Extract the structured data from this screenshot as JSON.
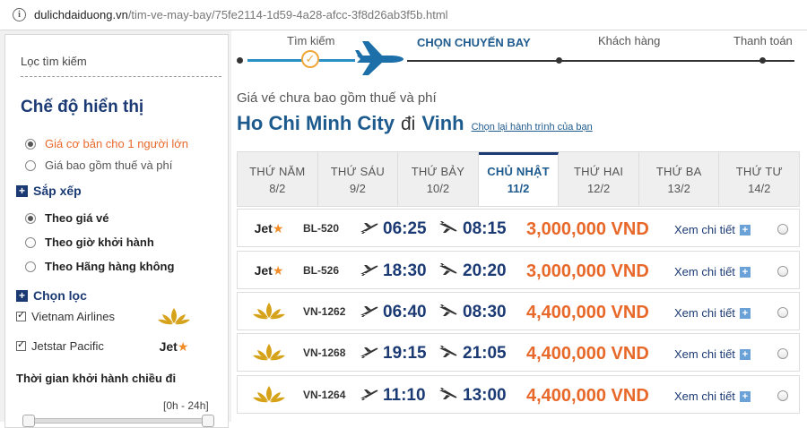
{
  "browser": {
    "url_host": "dulichdaiduong.vn",
    "url_path": "/tim-ve-may-bay/75fe2114-1d59-4a28-afcc-3f8d26ab3f5b.html"
  },
  "sidebar": {
    "filter_title": "Lọc tìm kiếm",
    "display_mode_title": "Chế độ hiển thị",
    "display_options": [
      {
        "label": "Giá cơ bản cho 1 người lớn",
        "selected": true
      },
      {
        "label": "Giá bao gồm thuế và phí",
        "selected": false
      }
    ],
    "sort_title": "Sắp xếp",
    "sort_options": [
      {
        "label": "Theo giá vé",
        "selected": true
      },
      {
        "label": "Theo giờ khởi hành",
        "selected": false
      },
      {
        "label": "Theo Hãng hàng không",
        "selected": false
      }
    ],
    "filter_section_title": "Chọn lọc",
    "airlines": [
      {
        "label": "Vietnam Airlines",
        "checked": true,
        "logo": "lotus-logo"
      },
      {
        "label": "Jetstar Pacific",
        "checked": true,
        "logo": "jetstar-logo"
      }
    ],
    "time_title": "Thời gian khởi hành chiều đi",
    "time_range": "[0h - 24h]"
  },
  "stepper": {
    "steps": [
      {
        "label": "Tìm kiếm",
        "state": "done"
      },
      {
        "label": "CHỌN CHUYẾN BAY",
        "state": "current"
      },
      {
        "label": "Khách hàng",
        "state": "todo"
      },
      {
        "label": "Thanh toán",
        "state": "todo"
      }
    ]
  },
  "results": {
    "note": "Giá vé chưa bao gồm thuế và phí",
    "from": "Ho Chi Minh City",
    "connector": "đi",
    "to": "Vinh",
    "change_link": "Chọn lại hành trình của bạn"
  },
  "day_tabs": [
    {
      "day": "THỨ NĂM",
      "date": "8/2",
      "active": false
    },
    {
      "day": "THỨ SÁU",
      "date": "9/2",
      "active": false
    },
    {
      "day": "THỨ BẢY",
      "date": "10/2",
      "active": false
    },
    {
      "day": "CHỦ NHẬT",
      "date": "11/2",
      "active": true
    },
    {
      "day": "THỨ HAI",
      "date": "12/2",
      "active": false
    },
    {
      "day": "THỨ BA",
      "date": "13/2",
      "active": false
    },
    {
      "day": "THỨ TƯ",
      "date": "14/2",
      "active": false
    }
  ],
  "flights": [
    {
      "airline": "jetstar-logo",
      "code": "BL-520",
      "depart": "06:25",
      "arrive": "08:15",
      "price": "3,000,000 VND",
      "detail": "Xem chi tiết"
    },
    {
      "airline": "jetstar-logo",
      "code": "BL-526",
      "depart": "18:30",
      "arrive": "20:20",
      "price": "3,000,000 VND",
      "detail": "Xem chi tiết"
    },
    {
      "airline": "lotus-logo",
      "code": "VN-1262",
      "depart": "06:40",
      "arrive": "08:30",
      "price": "4,400,000 VND",
      "detail": "Xem chi tiết"
    },
    {
      "airline": "lotus-logo",
      "code": "VN-1268",
      "depart": "19:15",
      "arrive": "21:05",
      "price": "4,400,000 VND",
      "detail": "Xem chi tiết"
    },
    {
      "airline": "lotus-logo",
      "code": "VN-1264",
      "depart": "11:10",
      "arrive": "13:00",
      "price": "4,400,000 VND",
      "detail": "Xem chi tiết"
    }
  ],
  "colors": {
    "brand_navy": "#1b3a74",
    "price_orange": "#e8682a",
    "link_blue": "#1d5a8e",
    "lotus_gold": "#d6a21a"
  },
  "logo_text": {
    "jetstar": "Jet"
  }
}
